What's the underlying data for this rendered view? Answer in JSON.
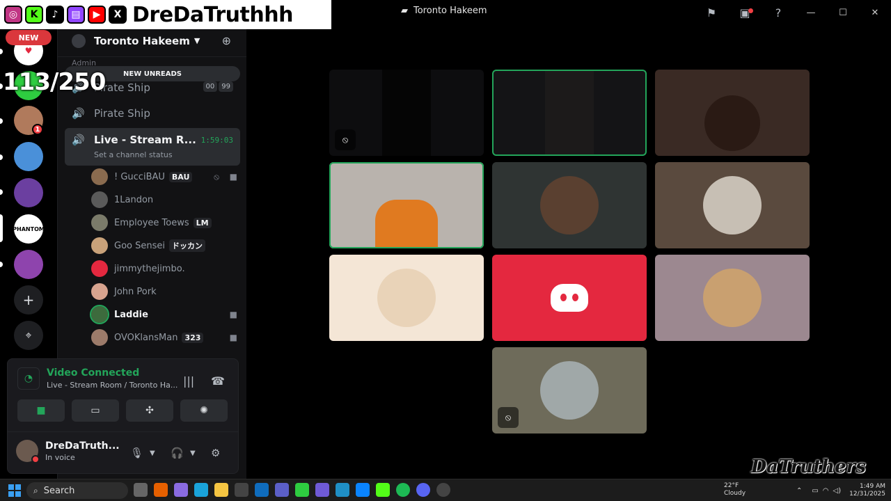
{
  "window": {
    "title": "Toronto Hakeem",
    "controls": {
      "minimize": "—",
      "maximize": "☐",
      "close": "✕"
    }
  },
  "overlay": {
    "handle": "DreDaTruthhh",
    "socials": [
      "instagram-icon",
      "kick-icon",
      "tiktok-icon",
      "twitch-icon",
      "youtube-icon",
      "x-icon"
    ],
    "counter": "113/250",
    "watermark": "DaTruthers"
  },
  "rail": {
    "new_label": "NEW",
    "servers": [
      {
        "name": "server-heart",
        "color": "#ffffff"
      },
      {
        "name": "server-kick-green",
        "color": "#2ecc40"
      },
      {
        "name": "server-avatar-1",
        "color": "#b07a5c",
        "badge": "1"
      },
      {
        "name": "server-avatar-2",
        "color": "#4a90d9"
      },
      {
        "name": "server-avatar-3",
        "color": "#6b3fa0"
      },
      {
        "name": "server-phantom",
        "color": "#ffffff"
      },
      {
        "name": "server-avatar-4",
        "color": "#8e44ad"
      }
    ],
    "add_label": "+",
    "discover_label": "⌖"
  },
  "sidebar": {
    "guild_name": "Toronto Hakeem",
    "admin_label": "Admin",
    "new_unreads": "NEW UNREADS",
    "channels": [
      {
        "name": "Pirate Ship",
        "tags": [
          "00",
          "99"
        ]
      },
      {
        "name": "Pirate Ship"
      },
      {
        "name": "Live - Stream R...",
        "timer": "1:59:03",
        "status": "Set a channel status"
      }
    ],
    "members": [
      {
        "name": "! GucciBAU",
        "tag": "BAU",
        "bold": false,
        "color": "#8a6b4f"
      },
      {
        "name": "1Landon",
        "bold": false,
        "color": "#5a5a5a"
      },
      {
        "name": "Employee Toews",
        "tag": "LM",
        "bold": false,
        "color": "#7b7b6a"
      },
      {
        "name": "Goo Sensei",
        "tag": "ドッカン",
        "bold": false,
        "color": "#c9a27a"
      },
      {
        "name": "jimmythejimbo.",
        "bold": false,
        "color": "#e4283f"
      },
      {
        "name": "John Pork",
        "bold": false,
        "color": "#d8a48f"
      },
      {
        "name": "Laddie",
        "bold": true,
        "color": "#3d6b3d"
      },
      {
        "name": "OVOKlansMan",
        "tag": "323",
        "bold": false,
        "color": "#9c7b6a"
      }
    ]
  },
  "voice_panel": {
    "title": "Video Connected",
    "subtitle": "Live - Stream Room / Toronto Ha...",
    "user_name": "DreDaTruth...",
    "user_status": "In voice"
  },
  "tiles": [
    {
      "name": "tile-dark-1",
      "bg": "#0d0d0f",
      "muted": true
    },
    {
      "name": "tile-dark-2",
      "bg": "#141416",
      "speaking": true
    },
    {
      "name": "tile-camera-room",
      "bg": "#3a2a24"
    },
    {
      "name": "tile-camera-streamer",
      "bg": "#b9b3ad",
      "speaking": true
    },
    {
      "name": "tile-bengals-avatar",
      "bg": "#2f3433",
      "ring": "#5a4030"
    },
    {
      "name": "tile-man-avatar",
      "bg": "#5a4a3e",
      "ring": "#c7bfb4"
    },
    {
      "name": "tile-anime-avatar",
      "bg": "#f4e6d6",
      "ring": "#f4e6d6"
    },
    {
      "name": "tile-discord-avatar",
      "bg": "#e4283f",
      "discord": true
    },
    {
      "name": "tile-pink-avatar",
      "bg": "#9c8890",
      "ring": "#c9a070"
    },
    {
      "name": "tile-house-avatar",
      "bg": "#6e6b5a",
      "ring": "#a0a8a8",
      "cam_off": true
    }
  ],
  "taskbar": {
    "search_placeholder": "Search",
    "weather_temp": "22°F",
    "weather_desc": "Cloudy",
    "time": "1:49 AM",
    "date": "12/31/2025"
  },
  "colors": {
    "accent_green": "#23a55a",
    "danger_red": "#f23f43",
    "sidebar_bg": "#121214"
  }
}
